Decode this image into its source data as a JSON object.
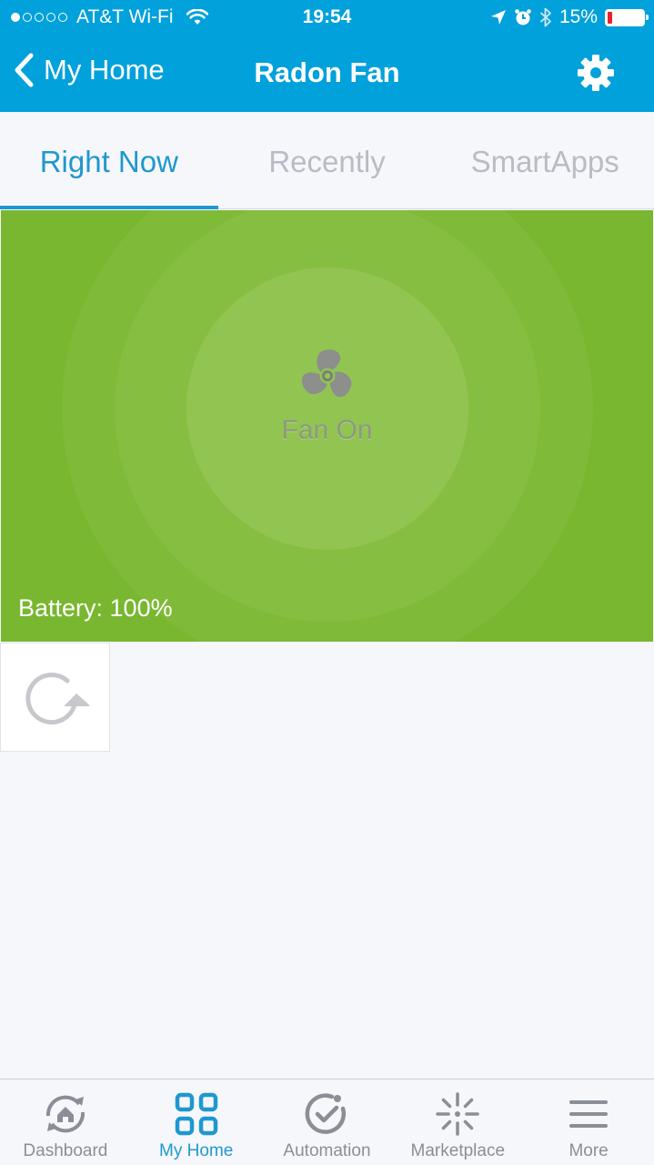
{
  "status_bar": {
    "carrier": "AT&T Wi-Fi",
    "time": "19:54",
    "battery_percent": "15%",
    "battery_level": 0.15,
    "signal_bars_filled": 1,
    "signal_bars_total": 5,
    "icons": [
      "wifi-icon",
      "location-icon",
      "alarm-icon",
      "bluetooth-icon",
      "battery-icon"
    ]
  },
  "nav": {
    "back_label": "My Home",
    "title": "Radon Fan",
    "settings_icon": "gear-icon"
  },
  "tabs": [
    {
      "label": "Right Now",
      "active": true
    },
    {
      "label": "Recently",
      "active": false
    },
    {
      "label": "SmartApps",
      "active": false
    }
  ],
  "tile": {
    "status_label": "Fan On",
    "status_icon": "fan-icon",
    "battery_text": "Battery: 100%",
    "background_color": "#78b72f"
  },
  "refresh": {
    "icon": "refresh-icon"
  },
  "bottom_nav": [
    {
      "label": "Dashboard",
      "icon": "dashboard-icon",
      "active": false
    },
    {
      "label": "My Home",
      "icon": "my-home-grid-icon",
      "active": true
    },
    {
      "label": "Automation",
      "icon": "automation-check-icon",
      "active": false
    },
    {
      "label": "Marketplace",
      "icon": "marketplace-icon",
      "active": false
    },
    {
      "label": "More",
      "icon": "more-menu-icon",
      "active": false
    }
  ],
  "colors": {
    "header": "#01a1db",
    "accent": "#1f98cf",
    "tab_inactive": "#b8bcc4",
    "tile_green": "#78b72f",
    "battery_low": "#e8232a"
  }
}
